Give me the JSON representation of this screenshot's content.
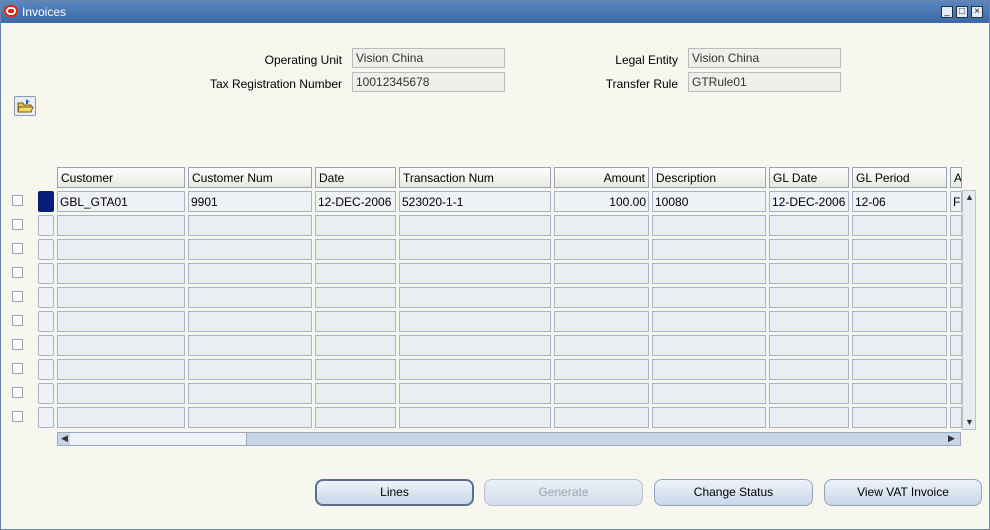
{
  "window": {
    "title": "Invoices"
  },
  "form": {
    "operating_unit_label": "Operating Unit",
    "operating_unit_value": "Vision China",
    "tax_reg_label": "Tax Registration Number",
    "tax_reg_value": "10012345678",
    "legal_entity_label": "Legal Entity",
    "legal_entity_value": "Vision China",
    "transfer_rule_label": "Transfer Rule",
    "transfer_rule_value": "GTRule01"
  },
  "table": {
    "columns": [
      "Customer",
      "Customer Num",
      "Date",
      "Transaction Num",
      "Amount",
      "Description",
      "GL Date",
      "GL Period",
      "A"
    ],
    "rows": [
      [
        "GBL_GTA01",
        "9901",
        "12-DEC-2006",
        "523020-1-1",
        "100.00",
        "10080",
        "12-DEC-2006",
        "12-06",
        "F"
      ]
    ],
    "empty_rows": 9
  },
  "buttons": {
    "lines": "Lines",
    "generate": "Generate",
    "change_status": "Change Status",
    "view_vat": "View VAT Invoice"
  },
  "colors": {
    "titlebar": "#3c69a6",
    "active_row": "#0a1e78",
    "background": "#f7f7ef"
  }
}
